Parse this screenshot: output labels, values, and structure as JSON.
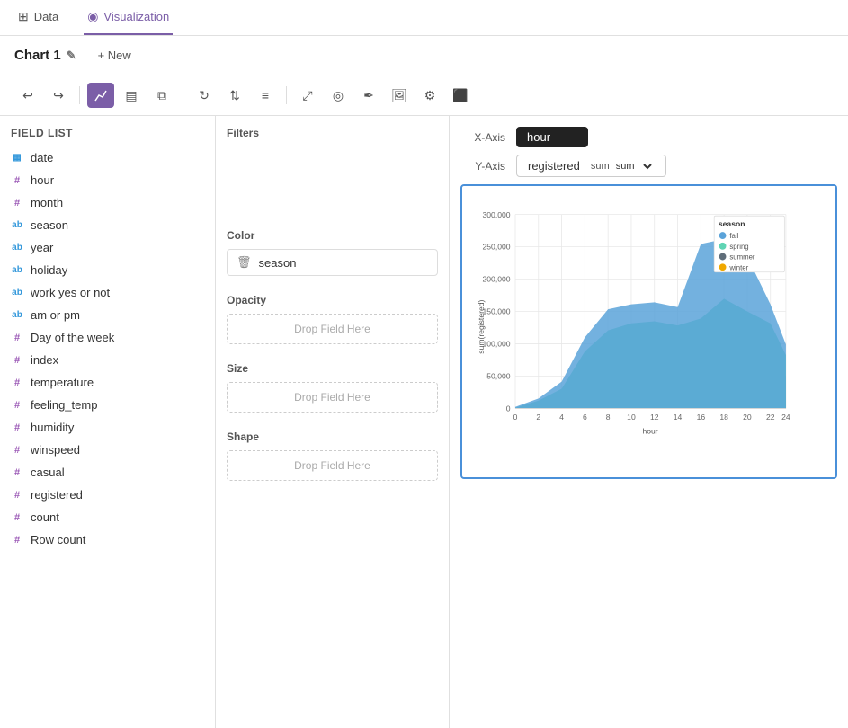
{
  "nav": {
    "tabs": [
      {
        "id": "data",
        "label": "Data",
        "icon": "⊞",
        "active": false
      },
      {
        "id": "visualization",
        "label": "Visualization",
        "icon": "◉",
        "active": true
      }
    ]
  },
  "subheader": {
    "chart_title": "Chart 1",
    "edit_icon": "✎",
    "new_btn_label": "+ New"
  },
  "toolbar": {
    "buttons": [
      {
        "id": "undo",
        "icon": "↩",
        "active": false
      },
      {
        "id": "redo",
        "icon": "↪",
        "active": false
      },
      {
        "id": "chart-type",
        "icon": "⬡",
        "active": true
      },
      {
        "id": "table-type",
        "icon": "▤",
        "active": false
      },
      {
        "id": "layers",
        "icon": "⧉",
        "active": false
      },
      {
        "id": "refresh",
        "icon": "↻",
        "active": false
      },
      {
        "id": "filter1",
        "icon": "⇅",
        "active": false
      },
      {
        "id": "filter2",
        "icon": "≡",
        "active": false
      },
      {
        "id": "spacer",
        "icon": "",
        "active": false
      },
      {
        "id": "expand",
        "icon": "⤢",
        "active": false
      },
      {
        "id": "settings2",
        "icon": "◎",
        "active": false
      },
      {
        "id": "pen",
        "icon": "✒",
        "active": false
      },
      {
        "id": "image",
        "icon": "⬜",
        "active": false
      },
      {
        "id": "settings3",
        "icon": "⚙",
        "active": false
      },
      {
        "id": "export",
        "icon": "⬛",
        "active": false
      }
    ]
  },
  "field_list": {
    "header": "Field List",
    "fields": [
      {
        "name": "date",
        "type": "date"
      },
      {
        "name": "hour",
        "type": "hash"
      },
      {
        "name": "month",
        "type": "hash"
      },
      {
        "name": "season",
        "type": "abc"
      },
      {
        "name": "year",
        "type": "abc"
      },
      {
        "name": "holiday",
        "type": "abc"
      },
      {
        "name": "work yes or not",
        "type": "abc"
      },
      {
        "name": "am or pm",
        "type": "abc"
      },
      {
        "name": "Day of the week",
        "type": "hash"
      },
      {
        "name": "index",
        "type": "hash"
      },
      {
        "name": "temperature",
        "type": "hash"
      },
      {
        "name": "feeling_temp",
        "type": "hash"
      },
      {
        "name": "humidity",
        "type": "hash"
      },
      {
        "name": "winspeed",
        "type": "hash"
      },
      {
        "name": "casual",
        "type": "hash"
      },
      {
        "name": "registered",
        "type": "hash"
      },
      {
        "name": "count",
        "type": "hash"
      },
      {
        "name": "Row count",
        "type": "hash"
      }
    ]
  },
  "config": {
    "filters_label": "Filters",
    "color_label": "Color",
    "color_field": "season",
    "opacity_label": "Opacity",
    "size_label": "Size",
    "shape_label": "Shape",
    "drop_field_here": "Drop Field Here"
  },
  "chart": {
    "x_axis_label": "X-Axis",
    "y_axis_label": "Y-Axis",
    "x_field": "hour",
    "y_field": "registered",
    "y_agg": "sum",
    "legend": {
      "title": "season",
      "items": [
        {
          "label": "fall",
          "color": "#5ba3d9"
        },
        {
          "label": "spring",
          "color": "#5fd4b4"
        },
        {
          "label": "summer",
          "color": "#606e7a"
        },
        {
          "label": "winter",
          "color": "#f0a800"
        }
      ]
    },
    "x_axis_title": "hour",
    "y_axis_title": "sum(registered)",
    "x_ticks": [
      "0",
      "2",
      "4",
      "6",
      "8",
      "10",
      "12",
      "14",
      "16",
      "18",
      "20",
      "22",
      "24"
    ],
    "y_ticks": [
      "0",
      "50,000",
      "100,000",
      "150,000",
      "200,000",
      "250,000",
      "300,000"
    ]
  }
}
